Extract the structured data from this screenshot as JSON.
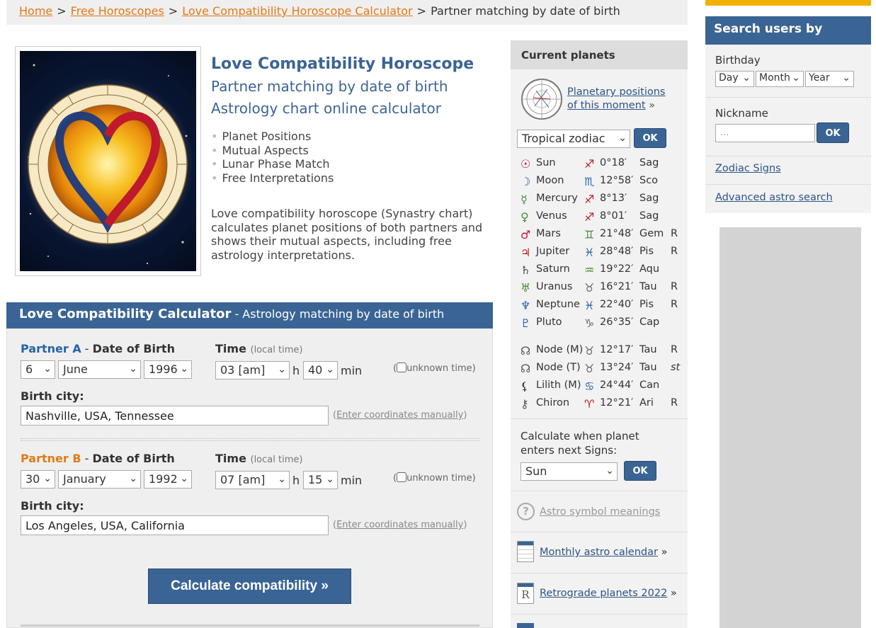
{
  "breadcrumb": {
    "items": [
      "Home",
      "Free Horoscopes",
      "Love Compatibility Horoscope Calculator"
    ],
    "sep": ">",
    "current": "Partner matching by date of birth"
  },
  "hero": {
    "title": "Love Compatibility Horoscope",
    "subtitle1": "Partner matching by date of birth",
    "subtitle2": "Astrology chart online calculator",
    "features": [
      "Planet Positions",
      "Mutual Aspects",
      "Lunar Phase Match",
      "Free Interpretations"
    ],
    "intro": "Love compatibility horoscope (Synastry chart) calculates planet positions of both partners and shows their mutual aspects, including free astrology interpretations."
  },
  "calculator": {
    "title": "Love Compatibility Calculator",
    "subtitle": " - Astrology matching by date of birth",
    "dob_label": "Date of Birth",
    "dash": " - ",
    "time_label": "Time",
    "time_hint": "(local time)",
    "h": "h",
    "min": "min",
    "unknown_time": "(☐unknown time)",
    "unknown_label": "unknown time)",
    "unknown_open": "(",
    "city_label": "Birth city:",
    "coords_link": "Enter coordinates manually",
    "partner_a": {
      "name": "Partner A",
      "day": "6",
      "month": "June",
      "year": "1996",
      "hour": "03 [am]",
      "minute": "40",
      "city": "Nashville, USA, Tennessee"
    },
    "partner_b": {
      "name": "Partner B",
      "day": "30",
      "month": "January",
      "year": "1992",
      "hour": "07 [am]",
      "minute": "15",
      "city": "Los Angeles, USA, California"
    },
    "submit": "Calculate compatibility »"
  },
  "sidebar": {
    "title": "Current planets",
    "positions_link": "Planetary positions of this moment",
    "positions_line1": "Planetary positions",
    "positions_line2": "of this moment",
    "raquo": "»",
    "zodiac_select": "Tropical zodiac",
    "ok": "OK",
    "planets": [
      {
        "glyph": "☉",
        "name": "Sun",
        "sign_glyph": "♐",
        "deg": "0°18′",
        "sign": "Sag",
        "flag": ""
      },
      {
        "glyph": "☽",
        "name": "Moon",
        "sign_glyph": "♏",
        "deg": "12°58′",
        "sign": "Sco",
        "flag": ""
      },
      {
        "glyph": "☿",
        "name": "Mercury",
        "sign_glyph": "♐",
        "deg": "8°13′",
        "sign": "Sag",
        "flag": ""
      },
      {
        "glyph": "♀",
        "name": "Venus",
        "sign_glyph": "♐",
        "deg": "8°01′",
        "sign": "Sag",
        "flag": ""
      },
      {
        "glyph": "♂",
        "name": "Mars",
        "sign_glyph": "♊",
        "deg": "21°48′",
        "sign": "Gem",
        "flag": "R"
      },
      {
        "glyph": "♃",
        "name": "Jupiter",
        "sign_glyph": "♓",
        "deg": "28°48′",
        "sign": "Pis",
        "flag": "R"
      },
      {
        "glyph": "♄",
        "name": "Saturn",
        "sign_glyph": "♒",
        "deg": "19°22′",
        "sign": "Aqu",
        "flag": ""
      },
      {
        "glyph": "♅",
        "name": "Uranus",
        "sign_glyph": "♉",
        "deg": "16°21′",
        "sign": "Tau",
        "flag": "R"
      },
      {
        "glyph": "♆",
        "name": "Neptune",
        "sign_glyph": "♓",
        "deg": "22°40′",
        "sign": "Pis",
        "flag": "R"
      },
      {
        "glyph": "♇",
        "name": "Pluto",
        "sign_glyph": "♑",
        "deg": "26°35′",
        "sign": "Cap",
        "flag": ""
      }
    ],
    "nodes": [
      {
        "glyph": "☊",
        "name": "Node (M)",
        "sign_glyph": "♉",
        "deg": "12°17′",
        "sign": "Tau",
        "flag": "R"
      },
      {
        "glyph": "☊",
        "name": "Node (T)",
        "sign_glyph": "♉",
        "deg": "13°24′",
        "sign": "Tau",
        "flag": "st"
      },
      {
        "glyph": "⚸",
        "name": "Lilith (M)",
        "sign_glyph": "♋",
        "deg": "24°44′",
        "sign": "Can",
        "flag": ""
      },
      {
        "glyph": "⚷",
        "name": "Chiron",
        "sign_glyph": "♈",
        "deg": "12°21′",
        "sign": "Ari",
        "flag": "R"
      }
    ],
    "next_signs_label": "Calculate when planet enters next Signs:",
    "next_signs_select": "Sun",
    "links": [
      "Astro symbol meanings",
      "Monthly astro calendar",
      "Retrograde planets 2022"
    ]
  },
  "search": {
    "title": "Search users by",
    "birthday_label": "Birthday",
    "day": "Day",
    "month": "Month",
    "year": "Year",
    "nickname_label": "Nickname",
    "nickname_placeholder": "...",
    "ok": "OK",
    "links": [
      "Zodiac Signs",
      "Advanced astro search"
    ]
  }
}
